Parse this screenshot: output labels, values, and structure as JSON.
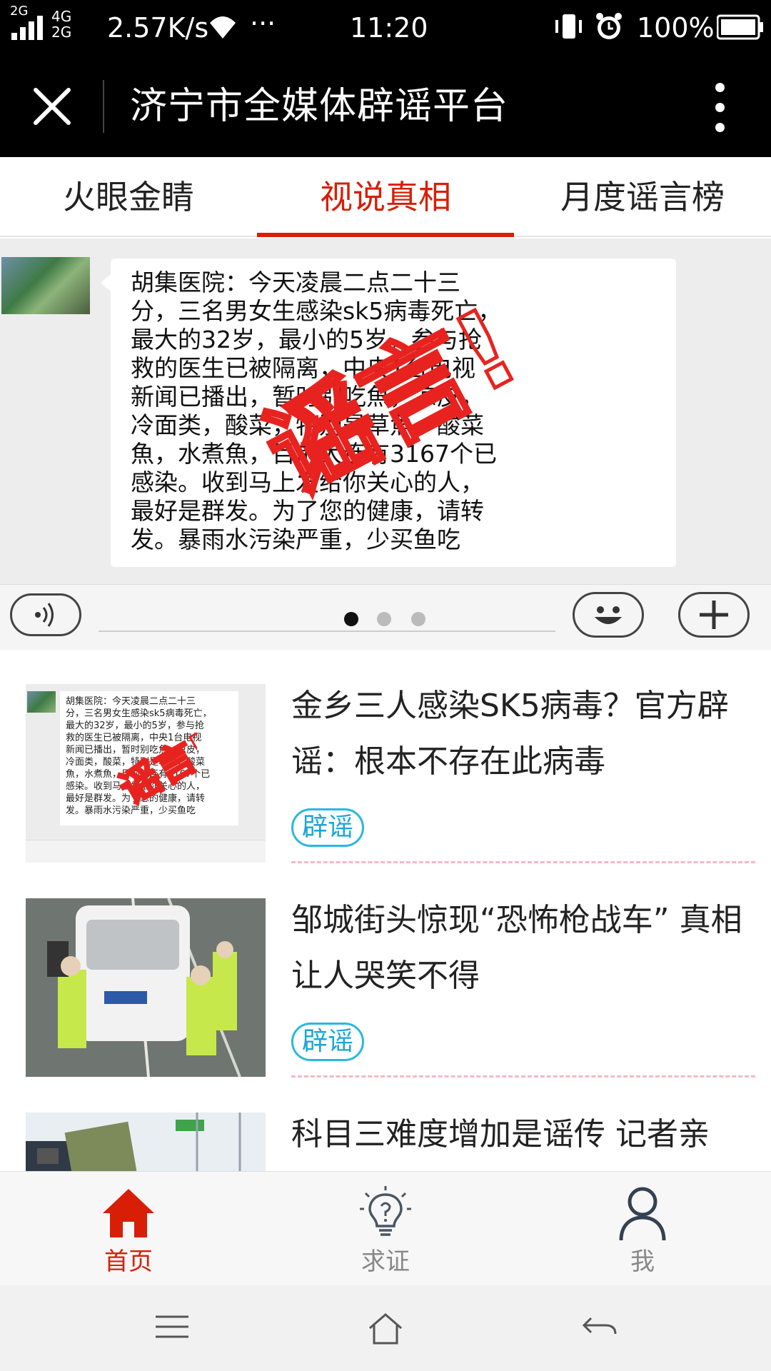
{
  "status_bar": {
    "network": "2G",
    "network2": "4G\n2G",
    "speed": "2.57K/s",
    "more": "···",
    "time": "11:20",
    "battery": "100%"
  },
  "title_bar": {
    "title": "济宁市全媒体辟谣平台",
    "close_icon": "close-icon",
    "more_icon": "more-vertical-icon"
  },
  "tabs": [
    {
      "label": "火眼金睛",
      "active": false
    },
    {
      "label": "视说真相",
      "active": true
    },
    {
      "label": "月度谣言榜",
      "active": false
    }
  ],
  "banner": {
    "message": "胡集医院：今天凌晨二点二十三\n分，三名男女生感染sk5病毒死亡，\n最大的32岁，最小的5岁，参与抢\n救的医生已被隔离，中央1台电视\n新闻已播出，暂时别吃魚，凉皮，\n冷面类，酸菜，特别是草魚，酸菜\n魚，水煮魚，目前大连有3167个已\n感染。收到马上发给你关心的人，\n最好是群发。为了您的健康，请转\n发。暴雨水污染严重，少买鱼吃",
    "stamp_text": "谣言!",
    "page_count": 3,
    "current_page": 1
  },
  "articles": [
    {
      "headline": "金乡三人感染SK5病毒？官方辟谣：根本不存在此病毒",
      "tag": "辟谣",
      "thumb_text": "胡集医院：今天凌晨二点二十三\n分，三名男女生感染sk5病毒死亡，\n最大的32岁，最小的5岁，参与抢\n救的医生已被隔离，中央1台电视\n新闻已播出，暂时别吃魚，凉皮，\n冷面类，酸菜，特别是草魚，酸菜\n魚，水煮魚，目前大连有3167个已\n感染。收到马上发给你关心的人，\n最好是群发。为了您的健康，请转\n发。暴雨水污染严重，少买鱼吃"
    },
    {
      "headline": "邹城街头惊现“恐怖枪战车” 真相让人哭笑不得",
      "tag": "辟谣"
    },
    {
      "headline": "科目三难度增加是谣传 记者亲",
      "tag": ""
    }
  ],
  "bottom_nav": [
    {
      "label": "首页",
      "icon": "home-icon",
      "active": true
    },
    {
      "label": "求证",
      "icon": "lightbulb-question-icon",
      "active": false
    },
    {
      "label": "我",
      "icon": "person-icon",
      "active": false
    }
  ],
  "colors": {
    "accent": "#d81e06",
    "tag_border": "#2ab7e3",
    "divider": "#f5b8c4"
  }
}
